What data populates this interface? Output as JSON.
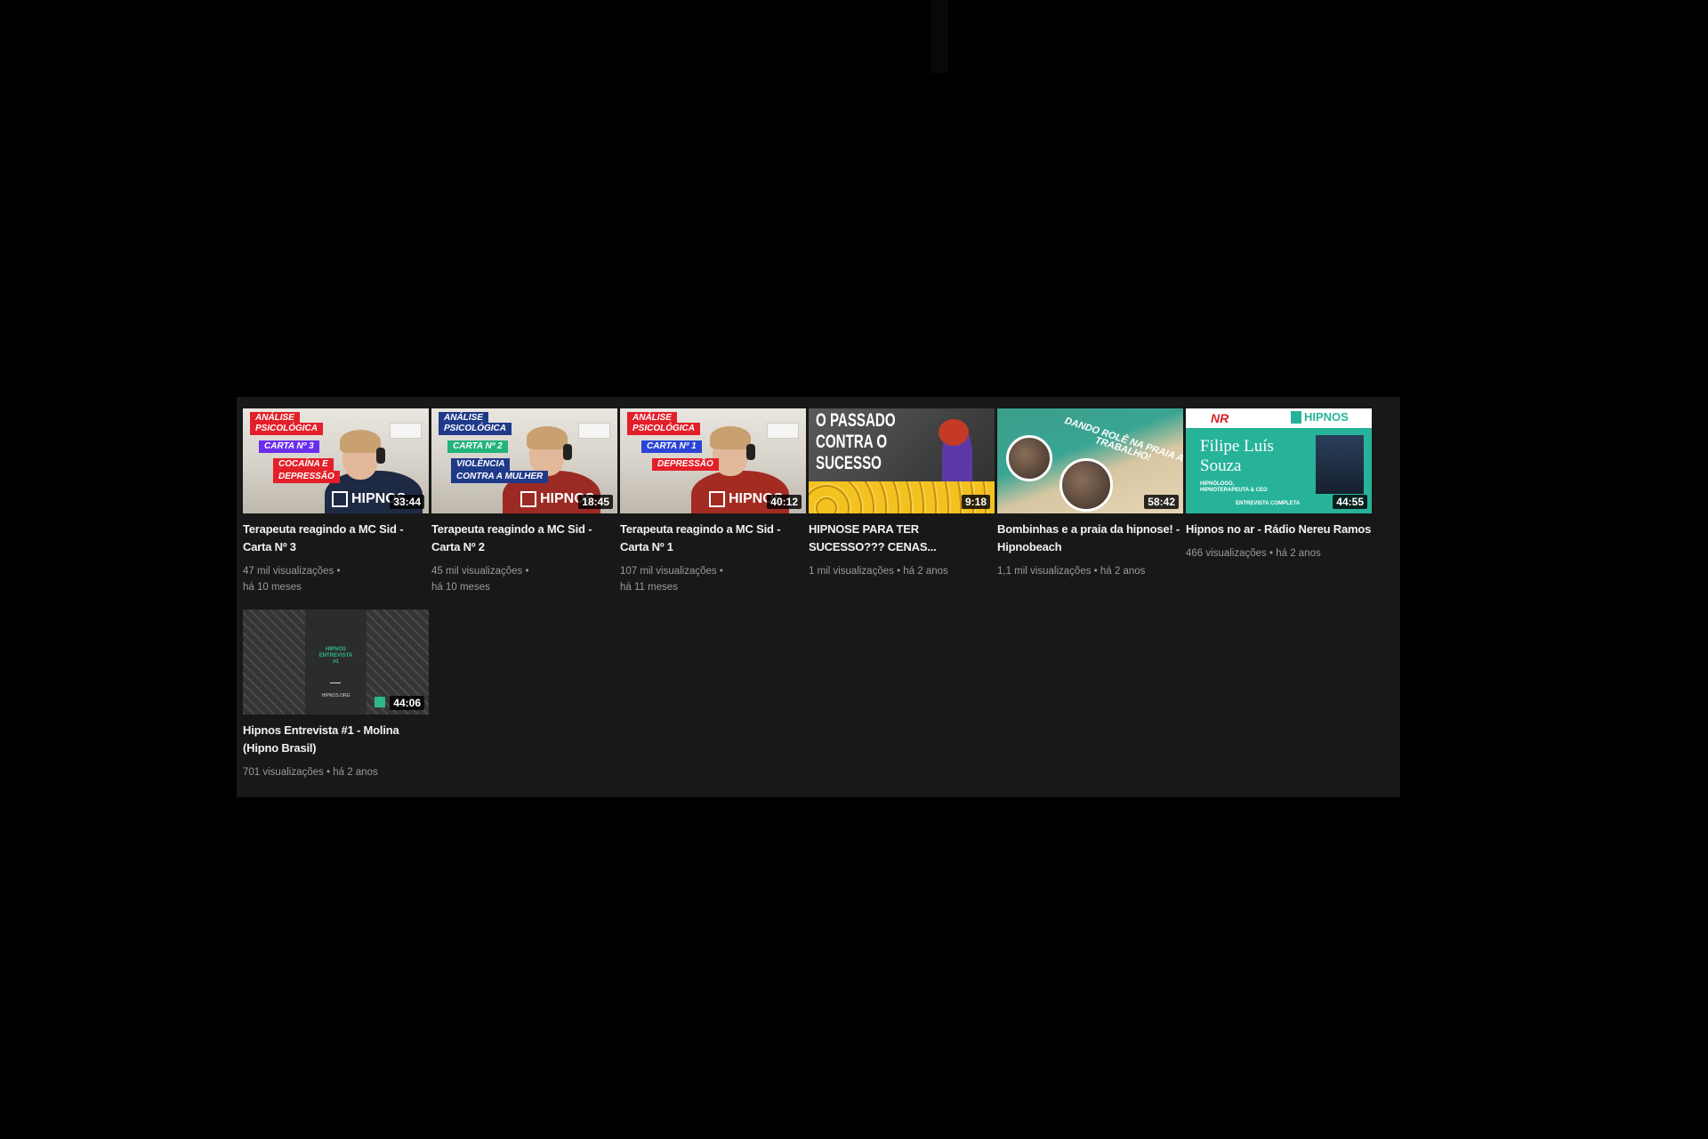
{
  "videos": [
    {
      "title": "Terapeuta reagindo a MC Sid - Carta Nº 3",
      "views": "47 mil visualizações",
      "age": "há 10 meses",
      "duration": "33:44",
      "thumb": {
        "tags": [
          "ANÁLISE",
          "PSICOLÓGICA",
          "CARTA Nº 3",
          "COCAÍNA E",
          "DEPRESSÃO"
        ],
        "logo": "HIPNOS",
        "shirt_color": "#1e2a44"
      }
    },
    {
      "title": "Terapeuta reagindo a MC Sid - Carta Nº 2",
      "views": "45 mil visualizações",
      "age": "há 10 meses",
      "duration": "18:45",
      "thumb": {
        "tags": [
          "ANÁLISE",
          "PSICOLÓGICA",
          "CARTA Nº 2",
          "VIOLÊNCIA",
          "CONTRA A MULHER"
        ],
        "logo": "HIPNOS",
        "shirt_color": "#9c2a24"
      }
    },
    {
      "title": "Terapeuta reagindo a MC Sid - Carta Nº 1",
      "views": "107 mil visualizações",
      "age": "há 11 meses",
      "duration": "40:12",
      "thumb": {
        "tags": [
          "ANÁLISE",
          "PSICOLÓGICA",
          "CARTA Nº 1",
          "DEPRESSÃO"
        ],
        "logo": "HIPNOS",
        "shirt_color": "#a32b22"
      }
    },
    {
      "title": "HIPNOSE PARA TER SUCESSO??? CENAS...",
      "views": "1 mil visualizações",
      "age": "há 2 anos",
      "duration": "9:18",
      "thumb": {
        "lines": [
          "O PASSADO",
          "CONTRA O",
          "SUCESSO"
        ]
      }
    },
    {
      "title": "Bombinhas e a praia da hipnose! - Hipnobeach",
      "views": "1,1 mil visualizações",
      "age": "há 2 anos",
      "duration": "58:42",
      "thumb": {
        "lines": [
          "DANDO ROLÊ NA PRAIA A",
          "TRABALHO!"
        ]
      }
    },
    {
      "title": "Hipnos no ar - Rádio Nereu Ramos",
      "views": "466 visualizações",
      "age": "há 2 anos",
      "duration": "44:55",
      "thumb": {
        "badge": "NR",
        "logo": "HIPNOS",
        "name_lines": [
          "Filipe Luís",
          "Souza"
        ],
        "small": [
          "HIPNÓLOGO,",
          "HIPNOTERAPEUTA & CEO",
          "ENTREVISTA COMPLETA"
        ]
      }
    },
    {
      "title": "Hipnos Entrevista #1 - Molina (Hipno Brasil)",
      "views": "701 visualizações",
      "age": "há 2 anos",
      "duration": "44:06",
      "thumb": {
        "lines": [
          "HIPNOS",
          "ENTREVISTA",
          "#1"
        ],
        "small": "HIPNOS.ORG"
      }
    }
  ]
}
